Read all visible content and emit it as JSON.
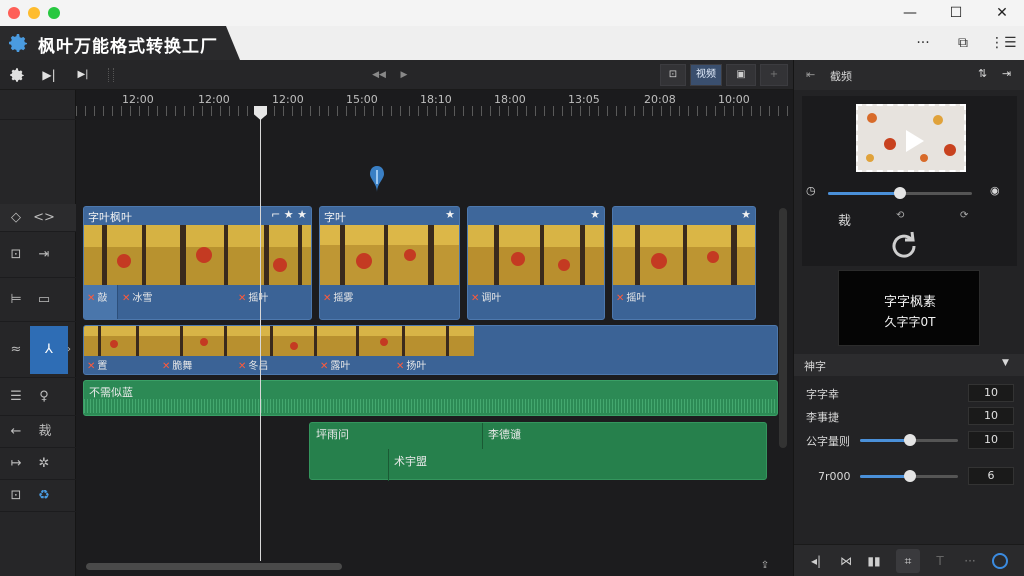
{
  "app": {
    "title": "枫叶万能格式转换工厂"
  },
  "window": {
    "minimize": "—",
    "maximize": "☐",
    "close": "✕"
  },
  "header_icons": [
    "···",
    "⧉",
    "⋮☰"
  ],
  "toolbar": {
    "nav_back": "◀◀",
    "nav_fwd": "▶",
    "seg_labels": [
      "⊡",
      "视频",
      "▣",
      "+"
    ]
  },
  "ruler": {
    "ticks": [
      "12:00",
      "12:00",
      "12:00",
      "15:00",
      "18:10",
      "18:00",
      "13:05",
      "20:08",
      "10:00"
    ]
  },
  "tracks": {
    "video1": [
      {
        "title": "字叶枫叶",
        "icons": "⌐ ★ ★",
        "subs": [
          "敲",
          "冰雪",
          "摇叶"
        ]
      },
      {
        "title": "字叶",
        "icons": "★",
        "subs": [
          "摇雾"
        ]
      },
      {
        "title": "",
        "icons": "★",
        "subs": [
          "调叶"
        ]
      },
      {
        "title": "",
        "icons": "★",
        "subs": [
          "摇叶"
        ]
      }
    ],
    "video2": {
      "subs": [
        "置",
        "脆舞",
        "冬吕",
        "露叶",
        "扬叶"
      ]
    },
    "audio1": {
      "label": "不需似蓝"
    },
    "audio2": {
      "labels": [
        "坪雨问",
        "李德谴",
        "术宇盟"
      ]
    }
  },
  "right_panel": {
    "header_label": "截频",
    "crop_label": "裁",
    "subtitle_preview": {
      "line1": "字字枫素",
      "line2": "久字字0T"
    },
    "section_title": "神字",
    "props": [
      {
        "label": "字字幸",
        "value": "10"
      },
      {
        "label": "李事捷",
        "value": "10"
      },
      {
        "label": "公字量则",
        "value": "10"
      },
      {
        "label": "7r000",
        "value": "6"
      }
    ]
  }
}
